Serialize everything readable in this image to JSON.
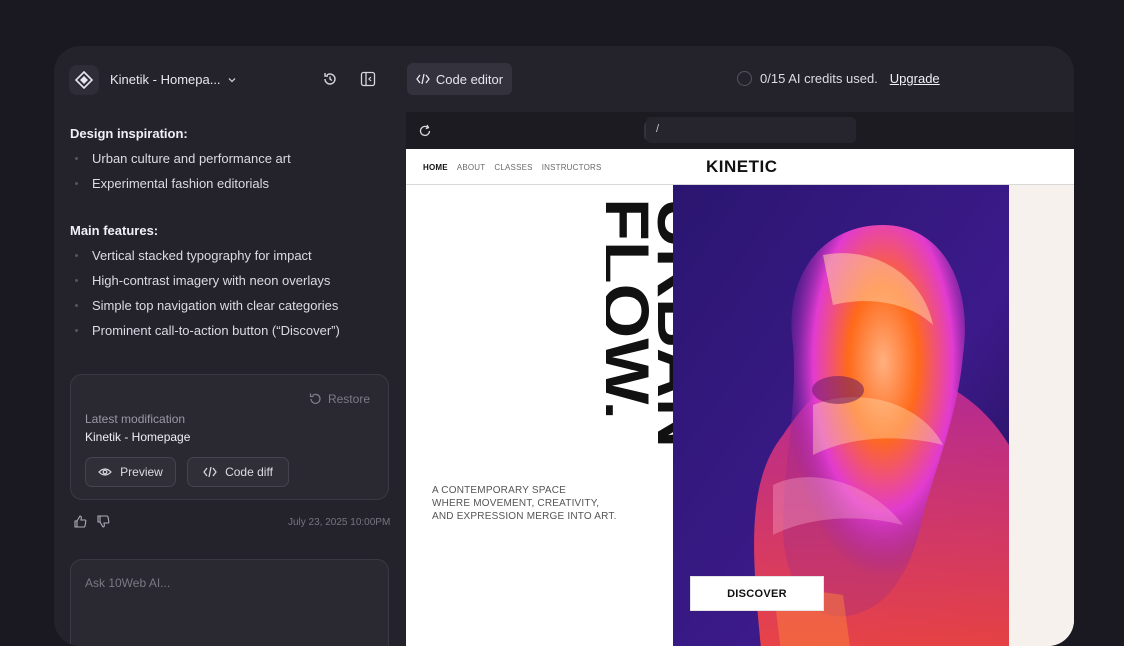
{
  "header": {
    "project_name": "Kinetik - Homepa...",
    "code_editor_label": "Code editor",
    "credits_text": "0/15 AI credits used.",
    "upgrade_label": "Upgrade"
  },
  "chat": {
    "inspiration": {
      "title": "Design inspiration:",
      "items": [
        "Urban culture and performance art",
        "Experimental fashion editorials"
      ]
    },
    "features": {
      "title": "Main features:",
      "items": [
        "Vertical stacked typography for impact",
        "High-contrast imagery with neon overlays",
        "Simple top navigation with clear categories",
        "Prominent call-to-action button (“Discover”)"
      ]
    },
    "modification": {
      "restore_label": "Restore",
      "label": "Latest modification",
      "name": "Kinetik - Homepage",
      "preview_label": "Preview",
      "code_diff_label": "Code diff"
    },
    "timestamp": "July 23, 2025 10:00PM",
    "ask_placeholder": "Ask 10Web AI..."
  },
  "preview": {
    "url": "/"
  },
  "site": {
    "nav": [
      "HOME",
      "ABOUT",
      "CLASSES",
      "INSTRUCTORS"
    ],
    "brand": "KINETIC",
    "hero_line1": "URBAN",
    "hero_line2": "FLOW.",
    "tagline": [
      "A CONTEMPORARY SPACE",
      "WHERE MOVEMENT, CREATIVITY,",
      "AND EXPRESSION MERGE INTO ART."
    ],
    "cta": "DISCOVER"
  },
  "icons": {
    "logo": "diamond-logo-icon",
    "history": "history-icon",
    "sidebar": "sidebar-toggle-icon",
    "code": "code-icon",
    "refresh": "refresh-icon",
    "desktop": "desktop-icon",
    "mobile": "mobile-icon",
    "thumbs_up": "thumbs-up-icon",
    "thumbs_down": "thumbs-down-icon",
    "eye": "eye-icon",
    "restore": "restore-icon",
    "chevron": "chevron-down-icon"
  },
  "colors": {
    "app_bg": "#24222b",
    "page_bg": "#1a1820",
    "hero_bg_start": "#2a1670",
    "neon_orange": "#ff6a1a",
    "neon_pink": "#e23bd0"
  }
}
